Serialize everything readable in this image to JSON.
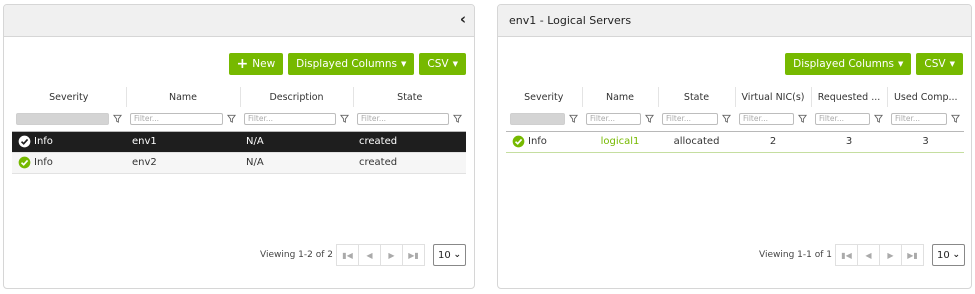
{
  "left": {
    "toolbar": {
      "new_label": "New",
      "columns_label": "Displayed Columns",
      "csv_label": "CSV"
    },
    "columns": [
      "Severity",
      "Name",
      "Description",
      "State"
    ],
    "filter_placeholder": "Filter...",
    "rows": [
      {
        "severity": "Info",
        "name": "env1",
        "description": "N/A",
        "state": "created"
      },
      {
        "severity": "Info",
        "name": "env2",
        "description": "N/A",
        "state": "created"
      }
    ],
    "viewing": "Viewing 1-2 of 2",
    "page_size": "10"
  },
  "right": {
    "title": "env1 - Logical Servers",
    "toolbar": {
      "columns_label": "Displayed Columns",
      "csv_label": "CSV"
    },
    "columns": [
      "Severity",
      "Name",
      "State",
      "Virtual NIC(s)",
      "Requested ...",
      "Used Comp..."
    ],
    "filter_placeholder": "Filter...",
    "rows": [
      {
        "severity": "Info",
        "name": "logical1",
        "state": "allocated",
        "vnics": "2",
        "requested": "3",
        "used": "3"
      }
    ],
    "viewing": "Viewing 1-1 of 1",
    "page_size": "10"
  },
  "icons": {
    "collapse": "chevron-left-icon",
    "new": "plus-icon",
    "filter": "funnel-icon",
    "severity_info": "check-circle-icon",
    "pager": [
      "first-page-icon",
      "prev-page-icon",
      "next-page-icon",
      "last-page-icon"
    ]
  },
  "colors": {
    "accent": "#76b900",
    "selected_row": "#1e1e1e",
    "header_bg": "#f0f0f0"
  }
}
